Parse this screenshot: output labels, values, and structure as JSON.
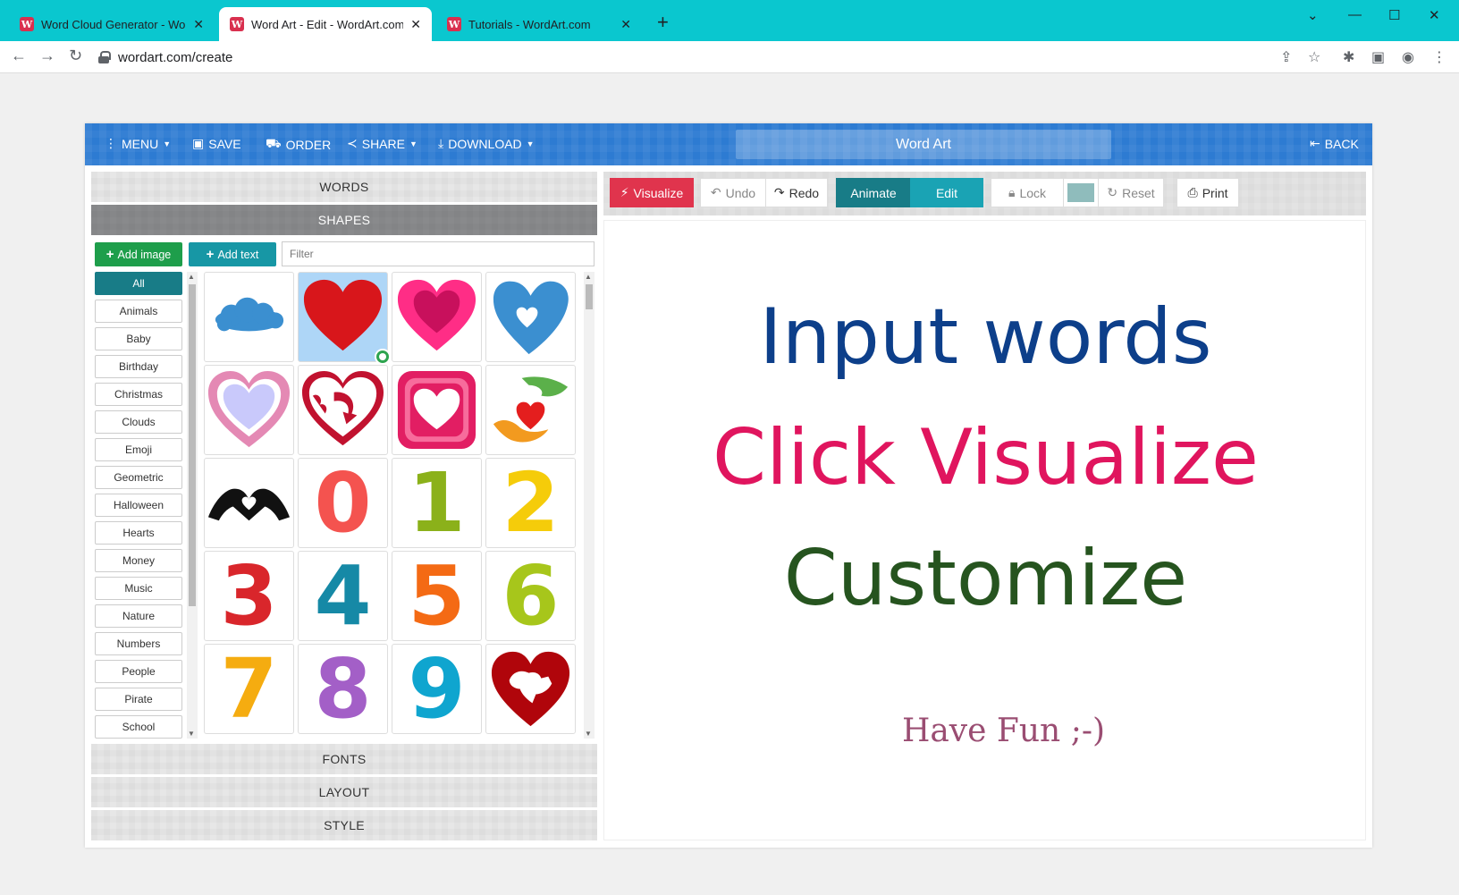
{
  "browser": {
    "tabs": [
      {
        "title": "Word Cloud Generator - WordArt.com",
        "icon": "wordart-favicon"
      },
      {
        "title": "Word Art - Edit - WordArt.com",
        "icon": "wordart-favicon"
      },
      {
        "title": "Tutorials - WordArt.com",
        "icon": "wordart-favicon"
      }
    ],
    "favicon_letter": "W",
    "url": "wordart.com/create"
  },
  "app": {
    "header": {
      "menu": "MENU",
      "save": "SAVE",
      "order": "ORDER",
      "share": "SHARE",
      "download": "DOWNLOAD",
      "title": "Word Art",
      "back": "BACK"
    },
    "left": {
      "words": "WORDS",
      "shapes": "SHAPES",
      "add_image": "Add image",
      "add_text": "Add text",
      "filter_placeholder": "Filter",
      "categories": [
        "All",
        "Animals",
        "Baby",
        "Birthday",
        "Christmas",
        "Clouds",
        "Emoji",
        "Geometric",
        "Halloween",
        "Hearts",
        "Money",
        "Music",
        "Nature",
        "Numbers",
        "People",
        "Pirate",
        "School"
      ],
      "shapes_grid": [
        {
          "name": "cloud-shape"
        },
        {
          "name": "red-heart-shape",
          "selected": true
        },
        {
          "name": "pink-heart-shape"
        },
        {
          "name": "blue-heart-shape"
        },
        {
          "name": "pastel-heart-shape"
        },
        {
          "name": "heart-arrow-shape"
        },
        {
          "name": "heart-in-frame-shape"
        },
        {
          "name": "hands-heart-shape"
        },
        {
          "name": "hands-heart-silhouette-shape"
        },
        {
          "name": "number-0-shape",
          "label": "0",
          "color": "#f4534f"
        },
        {
          "name": "number-1-shape",
          "label": "1",
          "color": "#8bb11a"
        },
        {
          "name": "number-2-shape",
          "label": "2",
          "color": "#f5cc0a"
        },
        {
          "name": "number-3-shape",
          "label": "3",
          "color": "#d9262b"
        },
        {
          "name": "number-4-shape",
          "label": "4",
          "color": "#1689a6"
        },
        {
          "name": "number-5-shape",
          "label": "5",
          "color": "#f46a14"
        },
        {
          "name": "number-6-shape",
          "label": "6",
          "color": "#a7c61b"
        },
        {
          "name": "number-7-shape",
          "label": "7",
          "color": "#f5ac10"
        },
        {
          "name": "number-8-shape",
          "label": "8",
          "color": "#a35fc7"
        },
        {
          "name": "number-9-shape",
          "label": "9",
          "color": "#0fa5cf"
        },
        {
          "name": "heart-dog-shape"
        }
      ],
      "fonts": "FONTS",
      "layout": "LAYOUT",
      "style": "STYLE"
    },
    "toolbar": {
      "visualize": "Visualize",
      "undo": "Undo",
      "redo": "Redo",
      "animate": "Animate",
      "edit": "Edit",
      "lock": "Lock",
      "reset": "Reset",
      "print": "Print"
    },
    "canvas": {
      "line1": "Input words",
      "line2": "Click Visualize",
      "line3": "Customize",
      "line4": "Have Fun ;-)"
    },
    "colors": {
      "header": "#2d7bd2",
      "visualize": "#e0344d",
      "animate": "#187c87",
      "edit": "#1aa3b4",
      "add_image": "#1e9e4b",
      "add_text": "#1797a5",
      "line1": "#0d3f8a",
      "line2": "#e0155e",
      "line3": "#26541f",
      "line4": "#9a4d72",
      "swatch": "#8fbcbc"
    }
  }
}
